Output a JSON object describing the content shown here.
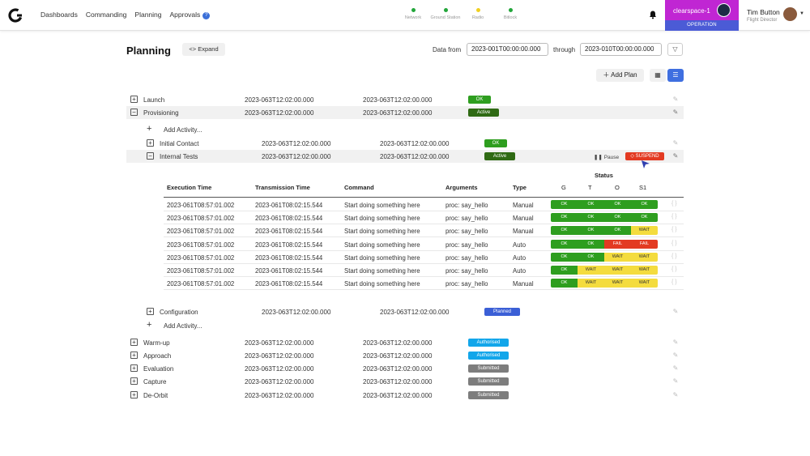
{
  "nav": {
    "items": [
      "Dashboards",
      "Commanding",
      "Planning",
      "Approvals"
    ],
    "approvals_count": "?"
  },
  "indicators": [
    {
      "label": "Network",
      "color": "#22a63a"
    },
    {
      "label": "Ground Station",
      "color": "#22a63a"
    },
    {
      "label": "Radio",
      "color": "#f0d020"
    },
    {
      "label": "Bitlock",
      "color": "#22a63a"
    }
  ],
  "environment": {
    "name": "clearspace-1",
    "mode": "OPERATION"
  },
  "user": {
    "name": "Tim Button",
    "role": "Flight Director"
  },
  "page": {
    "title": "Planning",
    "expand_label": "Expand",
    "data_from_label": "Data from",
    "from_value": "2023-001T00:00:00.000",
    "through_label": "through",
    "through_value": "2023-010T00:00:00.000",
    "add_plan_label": "Add Plan"
  },
  "status_colors": {
    "OK": "#2e9e1f",
    "Active": "#2f6a14",
    "Planned": "#3b5fd6",
    "Authorised": "#12a6ea",
    "Submitted": "#7d7d7d",
    "WAIT": "#f4dc3e",
    "FAIL": "#e33a22",
    "SUSPEND": "#e33a22"
  },
  "plans_top": [
    {
      "name": "Launch",
      "start": "2023-063T12:02:00.000",
      "end": "2023-063T12:02:00.000",
      "status": "OK",
      "toggle": "+"
    },
    {
      "name": "Provisioning",
      "start": "2023-063T12:02:00.000",
      "end": "2023-063T12:02:00.000",
      "status": "Active",
      "toggle": "−"
    }
  ],
  "add_activity_label": "Add Activity...",
  "activities": [
    {
      "name": "Initial Contact",
      "start": "2023-063T12:02:00.000",
      "end": "2023-063T12:02:00.000",
      "status": "OK",
      "toggle": "+"
    },
    {
      "name": "Internal Tests",
      "start": "2023-063T12:02:00.000",
      "end": "2023-063T12:02:00.000",
      "status": "Active",
      "toggle": "−",
      "pause_label": "Pause",
      "suspend_label": "SUSPEND"
    }
  ],
  "table": {
    "status_header": "Status",
    "headers": [
      "Execution Time",
      "Transmission Time",
      "Command",
      "Arguments",
      "Type",
      "G",
      "T",
      "O",
      "S1"
    ],
    "rows": [
      {
        "exec": "2023-061T08:57:01.002",
        "trans": "2023-061T08:02:15.544",
        "cmd": "Start doing something here",
        "args": "proc: say_hello",
        "type": "Manual",
        "st": [
          "OK",
          "OK",
          "OK",
          "OK"
        ]
      },
      {
        "exec": "2023-061T08:57:01.002",
        "trans": "2023-061T08:02:15.544",
        "cmd": "Start doing something here",
        "args": "proc: say_hello",
        "type": "Manual",
        "st": [
          "OK",
          "OK",
          "OK",
          "OK"
        ]
      },
      {
        "exec": "2023-061T08:57:01.002",
        "trans": "2023-061T08:02:15.544",
        "cmd": "Start doing something here",
        "args": "proc: say_hello",
        "type": "Manual",
        "st": [
          "OK",
          "OK",
          "OK",
          "WAIT"
        ]
      },
      {
        "exec": "2023-061T08:57:01.002",
        "trans": "2023-061T08:02:15.544",
        "cmd": "Start doing something here",
        "args": "proc: say_hello",
        "type": "Auto",
        "st": [
          "OK",
          "OK",
          "FAIL",
          "FAIL"
        ]
      },
      {
        "exec": "2023-061T08:57:01.002",
        "trans": "2023-061T08:02:15.544",
        "cmd": "Start doing something here",
        "args": "proc: say_hello",
        "type": "Auto",
        "st": [
          "OK",
          "OK",
          "WAIT",
          "WAIT"
        ]
      },
      {
        "exec": "2023-061T08:57:01.002",
        "trans": "2023-061T08:02:15.544",
        "cmd": "Start doing something here",
        "args": "proc: say_hello",
        "type": "Auto",
        "st": [
          "OK",
          "WAIT",
          "WAIT",
          "WAIT"
        ]
      },
      {
        "exec": "2023-061T08:57:01.002",
        "trans": "2023-061T08:02:15.544",
        "cmd": "Start doing something here",
        "args": "proc: say_hello",
        "type": "Manual",
        "st": [
          "OK",
          "WAIT",
          "WAIT",
          "WAIT"
        ]
      }
    ],
    "braces": "{ }"
  },
  "configuration": {
    "name": "Configuration",
    "start": "2023-063T12:02:00.000",
    "end": "2023-063T12:02:00.000",
    "status": "Planned",
    "toggle": "+"
  },
  "plans_bottom": [
    {
      "name": "Warm-up",
      "start": "2023-063T12:02:00.000",
      "end": "2023-063T12:02:00.000",
      "status": "Authorised",
      "toggle": "+"
    },
    {
      "name": "Approach",
      "start": "2023-063T12:02:00.000",
      "end": "2023-063T12:02:00.000",
      "status": "Authorised",
      "toggle": "+"
    },
    {
      "name": "Evaluation",
      "start": "2023-063T12:02:00.000",
      "end": "2023-063T12:02:00.000",
      "status": "Submitted",
      "toggle": "+"
    },
    {
      "name": "Capture",
      "start": "2023-063T12:02:00.000",
      "end": "2023-063T12:02:00.000",
      "status": "Submitted",
      "toggle": "+"
    },
    {
      "name": "De-Orbit",
      "start": "2023-063T12:02:00.000",
      "end": "2023-063T12:02:00.000",
      "status": "Submitted",
      "toggle": "+"
    }
  ]
}
